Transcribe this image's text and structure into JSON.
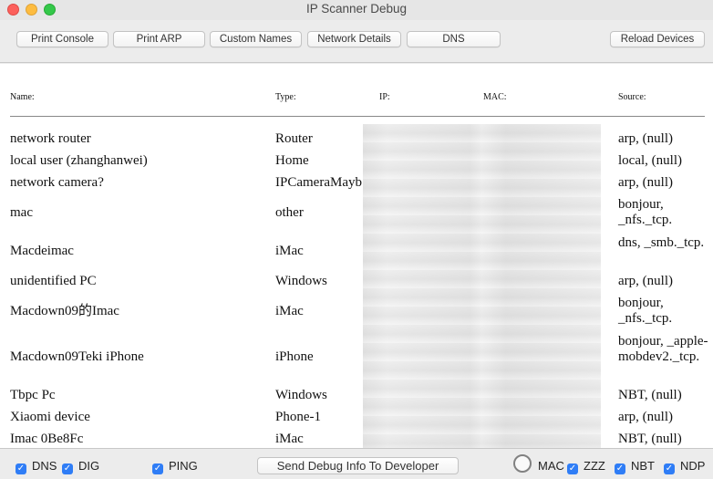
{
  "window": {
    "title": "IP Scanner Debug"
  },
  "toolbar": {
    "print_console": "Print Console",
    "print_arp": "Print ARP",
    "custom_names": "Custom Names",
    "network_details": "Network Details",
    "dns": "DNS",
    "reload_devices": "Reload Devices"
  },
  "table": {
    "headers": {
      "name": "Name:",
      "type": "Type:",
      "ip": "IP:",
      "mac": "MAC:",
      "source": "Source:"
    },
    "rows": [
      {
        "name": "network router",
        "type": "Router",
        "source": "arp, (null)"
      },
      {
        "name": "local user (zhanghanwei)",
        "type": "Home",
        "source": "local, (null)"
      },
      {
        "name": "network camera?",
        "type": "IPCameraMayb",
        "source": "arp, (null)"
      },
      {
        "name": "mac",
        "type": "other",
        "source": "bonjour, _nfs._tcp."
      },
      {
        "name": "Macdeimac",
        "type": "iMac",
        "source": "dns, _smb._tcp."
      },
      {
        "name": "unidentified PC",
        "type": "Windows",
        "source": "arp, (null)"
      },
      {
        "name": "Macdown09的Imac",
        "type": "iMac",
        "source": "bonjour, _nfs._tcp."
      },
      {
        "name": "Macdown09Teki iPhone",
        "type": "iPhone",
        "source": "bonjour, _apple-mobdev2._tcp."
      },
      {
        "name": "Tbpc Pc",
        "type": "Windows",
        "source": "NBT, (null)"
      },
      {
        "name": "Xiaomi device",
        "type": "Phone-1",
        "source": "arp, (null)"
      },
      {
        "name": "Imac 0Be8Fc",
        "type": "iMac",
        "source": "NBT, (null)"
      }
    ]
  },
  "bottom": {
    "dns": "DNS",
    "dig": "DIG",
    "ping": "PING",
    "send_debug": "Send Debug Info To Developer",
    "mac": "MAC",
    "zzz": "ZZZ",
    "nbt": "NBT",
    "ndp": "NDP"
  },
  "colors": {
    "accent": "#2f7df6",
    "close": "#fc605c",
    "minimize": "#fdbc40",
    "maximize": "#34c84a"
  }
}
